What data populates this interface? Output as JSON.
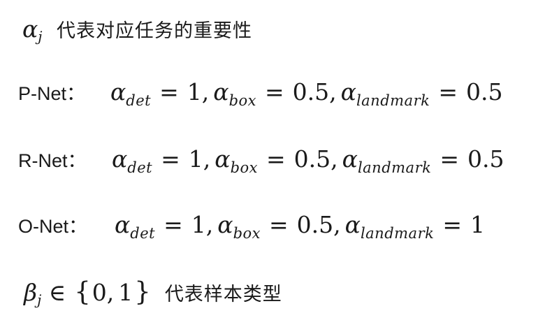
{
  "intro": {
    "symbol": "α",
    "symbol_sub": "j",
    "text": "代表对应任务的重要性"
  },
  "rows": [
    {
      "label": "P-Net：",
      "sym": "α",
      "det_sub": "det",
      "box_sub": "box",
      "landmark_sub": "landmark",
      "eq": "=",
      "det_val": "1",
      "box_val": "0.5",
      "landmark_val": "0.5"
    },
    {
      "label": "R-Net：",
      "sym": "α",
      "det_sub": "det",
      "box_sub": "box",
      "landmark_sub": "landmark",
      "eq": "=",
      "det_val": "1",
      "box_val": "0.5",
      "landmark_val": "0.5"
    },
    {
      "label": "O-Net：",
      "sym": "α",
      "det_sub": "det",
      "box_sub": "box",
      "landmark_sub": "landmark",
      "eq": "=",
      "det_val": "1",
      "box_val": "0.5",
      "landmark_val": "1"
    }
  ],
  "outro": {
    "symbol": "β",
    "symbol_sub": "j",
    "in": "∈",
    "open": "{",
    "v0": "0",
    "sep": ",",
    "v1": "1",
    "close": "}",
    "text": "代表样本类型"
  }
}
